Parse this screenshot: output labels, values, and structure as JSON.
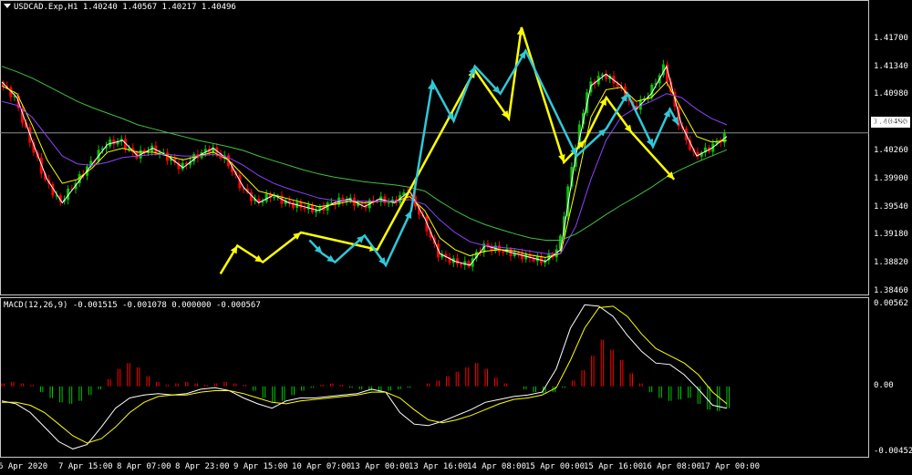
{
  "header": {
    "symbol_line": "USDCAD.Exp,H1  1.40240 1.40567 1.40217 1.40496"
  },
  "macd_header": "MACD(12,26,9) -0.001515 -0.001078 0.000000 -0.000567",
  "current_price_label": "1.40496",
  "colors": {
    "bull": "#00c800",
    "bear": "#ff0000",
    "yellow": "#ffff00",
    "cyan": "#30c8d8",
    "ma_white": "#ffffff",
    "ma_violet": "#9040ff",
    "ma_green": "#40c040"
  },
  "chart_data": [
    {
      "type": "line",
      "title": "USDCAD.Exp,H1",
      "ylim": [
        1.3846,
        1.4206
      ],
      "y_ticks": [
        "1.41700",
        "1.41340",
        "1.40980",
        "1.40620",
        "1.40260",
        "1.39900",
        "1.39540",
        "1.39180",
        "1.38820",
        "1.38460"
      ],
      "y_tick_values": [
        1.417,
        1.4134,
        1.4098,
        1.4062,
        1.4026,
        1.399,
        1.3954,
        1.3918,
        1.3882,
        1.3846
      ],
      "x_ticks": [
        "6 Apr 2020",
        "7 Apr 15:00",
        "8 Apr 07:00",
        "8 Apr 23:00",
        "9 Apr 15:00",
        "10 Apr 07:00",
        "13 Apr 00:00",
        "13 Apr 16:00",
        "14 Apr 08:00",
        "15 Apr 00:00",
        "15 Apr 16:00",
        "16 Apr 08:00",
        "17 Apr 00:00"
      ],
      "current_price": 1.40496,
      "series": [
        {
          "values": [
            1.4115,
            1.4095,
            1.404,
            1.399,
            1.396,
            1.3985,
            1.401,
            1.4035,
            1.404,
            1.402,
            1.403,
            1.402,
            1.4005,
            1.402,
            1.403,
            1.4015,
            1.398,
            1.396,
            1.397,
            1.396,
            1.3955,
            1.395,
            1.396,
            1.3965,
            1.3955,
            1.3965,
            1.396,
            1.3975,
            1.394,
            1.3895,
            1.3885,
            1.388,
            1.3905,
            1.39,
            1.3895,
            1.389,
            1.3885,
            1.39,
            1.402,
            1.411,
            1.4125,
            1.411,
            1.408,
            1.41,
            1.4135,
            1.406,
            1.402,
            1.403,
            1.4045
          ]
        },
        {
          "values": [
            1.411,
            1.41,
            1.406,
            1.4015,
            1.3985,
            1.399,
            1.4005,
            1.4025,
            1.403,
            1.4025,
            1.4025,
            1.402,
            1.4015,
            1.402,
            1.4025,
            1.4015,
            1.3995,
            1.3975,
            1.397,
            1.3965,
            1.396,
            1.3955,
            1.3958,
            1.3962,
            1.396,
            1.3962,
            1.3962,
            1.3968,
            1.395,
            1.3915,
            1.39,
            1.3892,
            1.3898,
            1.39,
            1.3898,
            1.3893,
            1.389,
            1.3895,
            1.398,
            1.407,
            1.4105,
            1.4108,
            1.409,
            1.4095,
            1.4115,
            1.408,
            1.4045,
            1.4038,
            1.404
          ]
        },
        {
          "values": [
            1.409,
            1.4085,
            1.407,
            1.4045,
            1.402,
            1.401,
            1.4008,
            1.4012,
            1.4018,
            1.402,
            1.4022,
            1.4022,
            1.402,
            1.402,
            1.4022,
            1.4018,
            1.4008,
            1.3995,
            1.3985,
            1.3978,
            1.3972,
            1.3966,
            1.3963,
            1.3963,
            1.3962,
            1.3962,
            1.3962,
            1.3964,
            1.3958,
            1.3938,
            1.3922,
            1.391,
            1.3905,
            1.3903,
            1.3901,
            1.3898,
            1.3895,
            1.3895,
            1.393,
            1.399,
            1.404,
            1.407,
            1.4082,
            1.409,
            1.41,
            1.4095,
            1.408,
            1.4068,
            1.406
          ]
        },
        {
          "values": [
            1.4135,
            1.4128,
            1.412,
            1.411,
            1.41,
            1.409,
            1.4082,
            1.4075,
            1.4068,
            1.406,
            1.4055,
            1.405,
            1.4045,
            1.404,
            1.4036,
            1.4032,
            1.4027,
            1.402,
            1.4014,
            1.4008,
            1.4002,
            1.3997,
            1.3993,
            1.399,
            1.3987,
            1.3985,
            1.3983,
            1.398,
            1.3975,
            1.3962,
            1.395,
            1.394,
            1.3932,
            1.3926,
            1.392,
            1.3915,
            1.3912,
            1.3912,
            1.392,
            1.3932,
            1.3945,
            1.3957,
            1.3968,
            1.398,
            1.3993,
            1.4003,
            1.4012,
            1.402,
            1.4028
          ]
        }
      ],
      "annotations": {
        "yellow_zigzag": [
          [
            52,
            1.3869
          ],
          [
            56,
            1.3905
          ],
          [
            62,
            1.3884
          ],
          [
            71,
            1.3922
          ],
          [
            89,
            1.39
          ],
          [
            112,
            1.413
          ],
          [
            120,
            1.4068
          ],
          [
            123,
            1.4185
          ],
          [
            133,
            1.4012
          ],
          [
            138,
            1.404
          ],
          [
            143,
            1.4095
          ],
          [
            149,
            1.405
          ],
          [
            159,
            1.399
          ]
        ],
        "cyan_zigzag": [
          [
            73,
            1.3912
          ],
          [
            76,
            1.3895
          ],
          [
            79,
            1.3884
          ],
          [
            86,
            1.3918
          ],
          [
            91,
            1.388
          ],
          [
            97,
            1.395
          ],
          [
            102,
            1.4115
          ],
          [
            107,
            1.4065
          ],
          [
            112,
            1.4135
          ],
          [
            118,
            1.41
          ],
          [
            124,
            1.4155
          ],
          [
            136,
            1.402
          ],
          [
            143,
            1.4055
          ],
          [
            148,
            1.41
          ],
          [
            154,
            1.4032
          ],
          [
            158,
            1.408
          ],
          [
            160,
            1.406
          ]
        ]
      }
    },
    {
      "type": "bar",
      "title": "MACD(12,26,9)",
      "ylim": [
        -0.004526,
        0.00562
      ],
      "y_ticks": [
        "0.00562",
        "0.00",
        "-0.004526"
      ],
      "y_tick_values": [
        0.00562,
        0.0,
        -0.004526
      ],
      "histogram": [
        0.0002,
        0.0003,
        0.0002,
        0.0001,
        -0.0004,
        -0.0008,
        -0.0011,
        -0.0012,
        -0.001,
        -0.0006,
        -0.0002,
        0.0005,
        0.0012,
        0.0016,
        0.0013,
        0.0007,
        0.0003,
        0.0001,
        0.0002,
        0.0003,
        0.0002,
        0.0001,
        0.0002,
        0.0003,
        0.0002,
        0.0001,
        -0.0003,
        -0.0008,
        -0.0011,
        -0.001,
        -0.0006,
        -0.0003,
        -0.0001,
        0.0001,
        0.0002,
        0.0001,
        -0.0001,
        -0.0002,
        -0.0003,
        -0.0004,
        -0.0003,
        -0.0002,
        -0.0001,
        0.0,
        0.0002,
        0.0004,
        0.0007,
        0.001,
        0.0013,
        0.0016,
        0.0012,
        0.0006,
        0.0002,
        0.0,
        -0.0002,
        -0.0004,
        -0.0005,
        -0.0004,
        -0.0001,
        0.0004,
        0.0011,
        0.0021,
        0.0032,
        0.0025,
        0.0018,
        0.0009,
        0.0002,
        -0.0004,
        -0.0008,
        -0.001,
        -0.0009,
        -0.0008,
        -0.0012,
        -0.0016,
        -0.0017,
        -0.0015
      ],
      "series": [
        {
          "values": [
            -0.001,
            -0.0012,
            -0.0018,
            -0.0028,
            -0.0038,
            -0.0043,
            -0.004,
            -0.0028,
            -0.0015,
            -0.0008,
            -0.0006,
            -0.0005,
            -0.0006,
            -0.0005,
            -0.0002,
            -0.0001,
            -0.0003,
            -0.0008,
            -0.0012,
            -0.0015,
            -0.001,
            -0.0008,
            -0.0008,
            -0.0007,
            -0.0006,
            -0.0005,
            -0.0002,
            -0.0004,
            -0.0018,
            -0.0026,
            -0.0027,
            -0.0024,
            -0.002,
            -0.0016,
            -0.0011,
            -0.0009,
            -0.0007,
            -0.0006,
            -0.0004,
            0.0012,
            0.004,
            0.0056,
            0.0055,
            0.0048,
            0.0035,
            0.0024,
            0.0016,
            0.0015,
            0.0008,
            -0.0002,
            -0.0013,
            -0.0015
          ]
        },
        {
          "values": [
            -0.0011,
            -0.0011,
            -0.0013,
            -0.0018,
            -0.0026,
            -0.0034,
            -0.0039,
            -0.0036,
            -0.0028,
            -0.0018,
            -0.0011,
            -0.0007,
            -0.0006,
            -0.0006,
            -0.0004,
            -0.0003,
            -0.0003,
            -0.0005,
            -0.0008,
            -0.0011,
            -0.0012,
            -0.001,
            -0.0009,
            -0.0008,
            -0.0007,
            -0.0006,
            -0.0004,
            -0.0004,
            -0.0008,
            -0.0016,
            -0.0023,
            -0.0025,
            -0.0023,
            -0.002,
            -0.0016,
            -0.0012,
            -0.0009,
            -0.0008,
            -0.0006,
            -0.0001,
            0.0018,
            0.004,
            0.0054,
            0.0055,
            0.0048,
            0.0036,
            0.0026,
            0.0021,
            0.0016,
            0.0008,
            -0.0004,
            -0.0012
          ]
        }
      ]
    }
  ]
}
